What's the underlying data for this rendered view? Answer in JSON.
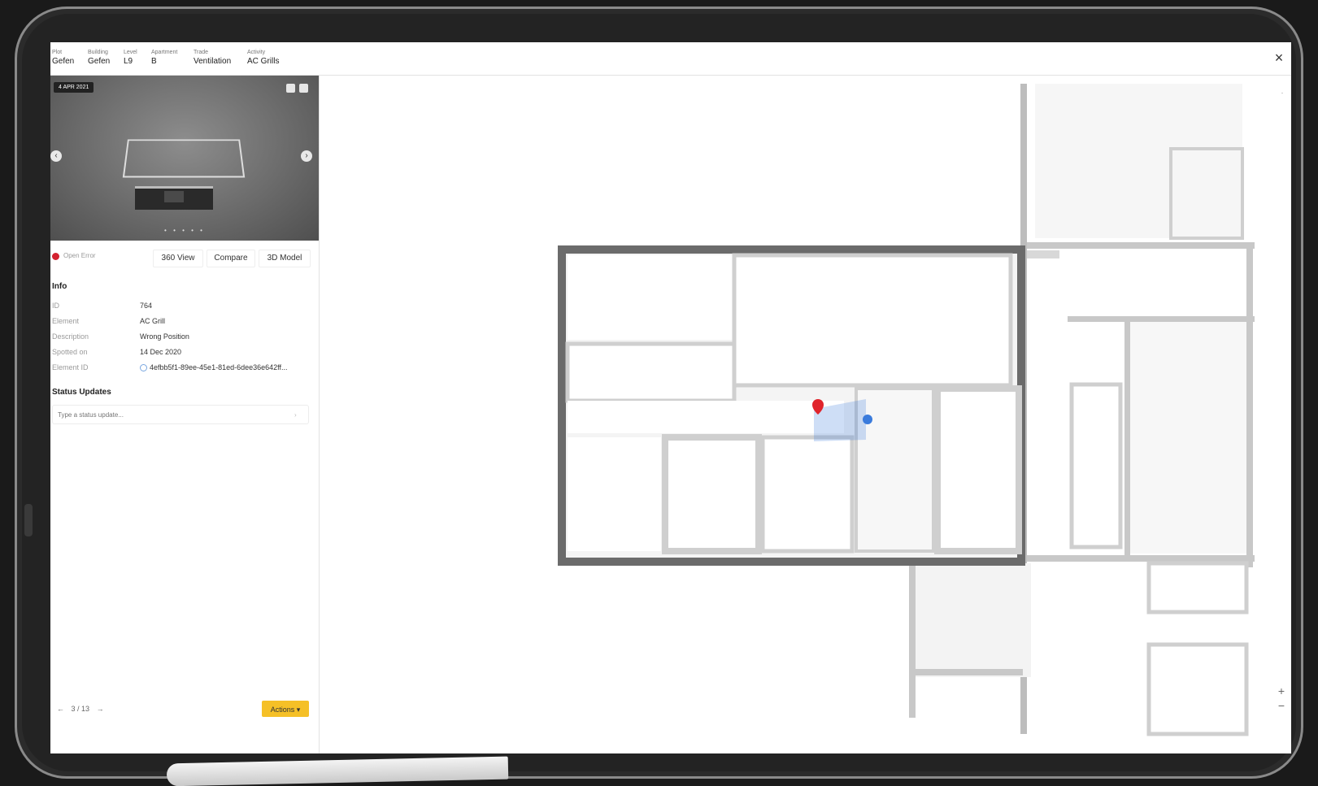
{
  "header": {
    "breadcrumbs": [
      {
        "key": "Plot",
        "value": "Gefen"
      },
      {
        "key": "Building",
        "value": "Gefen"
      },
      {
        "key": "Level",
        "value": "L9"
      },
      {
        "key": "Apartment",
        "value": "B"
      },
      {
        "key": "Trade",
        "value": "Ventilation"
      },
      {
        "key": "Activity",
        "value": "AC Grills"
      }
    ],
    "close_icon": "close-icon"
  },
  "photo": {
    "date": "4 APR 2021",
    "dots": "• • • • •"
  },
  "status": {
    "label": "Open Error",
    "color": "#d3212f"
  },
  "view_buttons": {
    "view360": "360 View",
    "compare": "Compare",
    "model3d": "3D Model"
  },
  "info": {
    "title": "Info",
    "rows": [
      {
        "key": "ID",
        "value": "764"
      },
      {
        "key": "Element",
        "value": "AC Grill"
      },
      {
        "key": "Description",
        "value": "Wrong Position"
      },
      {
        "key": "Spotted on",
        "value": "14 Dec 2020"
      },
      {
        "key": "Element ID",
        "value": "4efbb5f1-89ee-45e1-81ed-6dee36e642ff..."
      }
    ]
  },
  "status_updates": {
    "title": "Status Updates",
    "placeholder": "Type a status update..."
  },
  "pager": {
    "text": "3 / 13",
    "prev": "←",
    "next": "→"
  },
  "actions": {
    "label": "Actions ▾",
    "color": "#f5c027"
  },
  "map": {
    "zoom_in": "+",
    "zoom_out": "−",
    "marker_color": "#e0242c",
    "camera_color": "#3a7bdc"
  }
}
